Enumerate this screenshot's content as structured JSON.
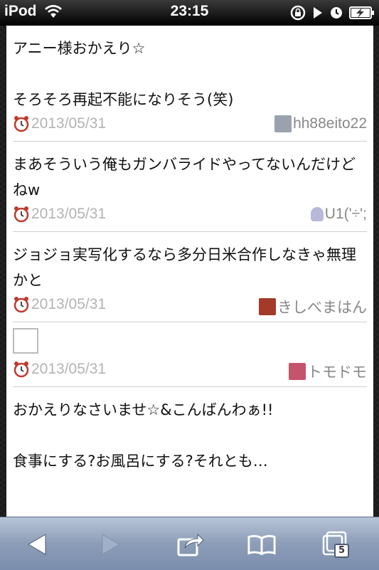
{
  "statusbar": {
    "carrier": "iPod",
    "time": "23:15"
  },
  "posts": [
    {
      "text": "アニー様おかえり☆\n\nそろそろ再起不能になりそう(笑)",
      "date": "2013/05/31",
      "user": "hh88eito22",
      "avatar_color": "#9aa3ad"
    },
    {
      "text": "まあそういう俺もガンバライドやってないんだけどねw",
      "date": "2013/05/31",
      "user": "U1('÷';",
      "avatar_color": "#b8b8d8"
    },
    {
      "text": "ジョジョ実写化するなら多分日米合作しなきゃ無理かと",
      "date": "2013/05/31",
      "user": "きしべまはん",
      "avatar_color": "#a33a2a"
    },
    {
      "text": "",
      "date": "2013/05/31",
      "user": "トモドモ",
      "avatar_color": "#c4546b"
    },
    {
      "text": "おかえりなさいませ☆&こんばんわぁ!!\n\n食事にする?お風呂にする?それとも…",
      "date": "",
      "user": "",
      "avatar_color": ""
    }
  ],
  "toolbar": {
    "tabs_count": "5"
  }
}
